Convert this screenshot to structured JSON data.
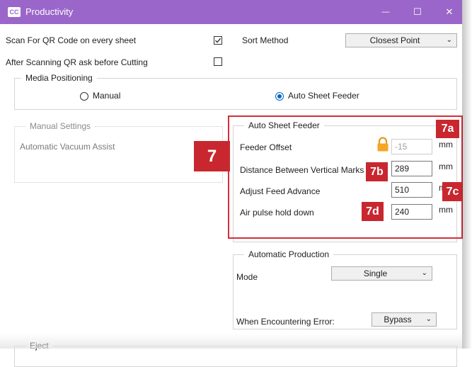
{
  "window": {
    "logo": "CC",
    "title": "Productivity",
    "minimize_glyph": "—",
    "maximize_glyph": "☐",
    "close_glyph": "✕"
  },
  "options": {
    "scan_qr_label": "Scan For QR Code on every sheet",
    "scan_qr_checked": true,
    "ask_before_cut_label": "After Scanning QR ask before Cutting",
    "ask_before_cut_checked": false
  },
  "sort": {
    "label": "Sort Method",
    "value": "Closest Point"
  },
  "media_positioning": {
    "title": "Media Positioning",
    "manual_label": "Manual",
    "auto_label": "Auto Sheet Feeder",
    "selected": "auto"
  },
  "manual_settings": {
    "title": "Manual Settings",
    "vacuum_label": "Automatic Vacuum Assist"
  },
  "auto_sheet_feeder": {
    "title": "Auto Sheet Feeder",
    "feeder_offset": {
      "label": "Feeder Offset",
      "value": "-15",
      "unit": "mm",
      "locked": true
    },
    "distance_marks": {
      "label": "Distance Between Vertical Marks",
      "value": "289",
      "unit": "mm"
    },
    "feed_advance": {
      "label": "Adjust Feed Advance",
      "value": "510",
      "unit": "mm"
    },
    "air_pulse": {
      "label": "Air pulse hold down",
      "value": "240",
      "unit": "mm"
    }
  },
  "automatic_production": {
    "title": "Automatic Production",
    "mode_label": "Mode",
    "mode_value": "Single",
    "error_label": "When Encountering Error:",
    "error_value": "Bypass"
  },
  "eject": {
    "title": "Eject"
  },
  "annotations": {
    "main": "7",
    "a": "7a",
    "b": "7b",
    "c": "7c",
    "d": "7d",
    "color": "#c8272f"
  },
  "colors": {
    "titlebar": "#9b66c9",
    "radio_selected": "#0067c0",
    "callout": "#d32f3a",
    "lock": "#f5a623"
  },
  "icons": {
    "checkbox_checked": "check-mark",
    "dropdown": "chevron-down",
    "lock": "padlock"
  }
}
